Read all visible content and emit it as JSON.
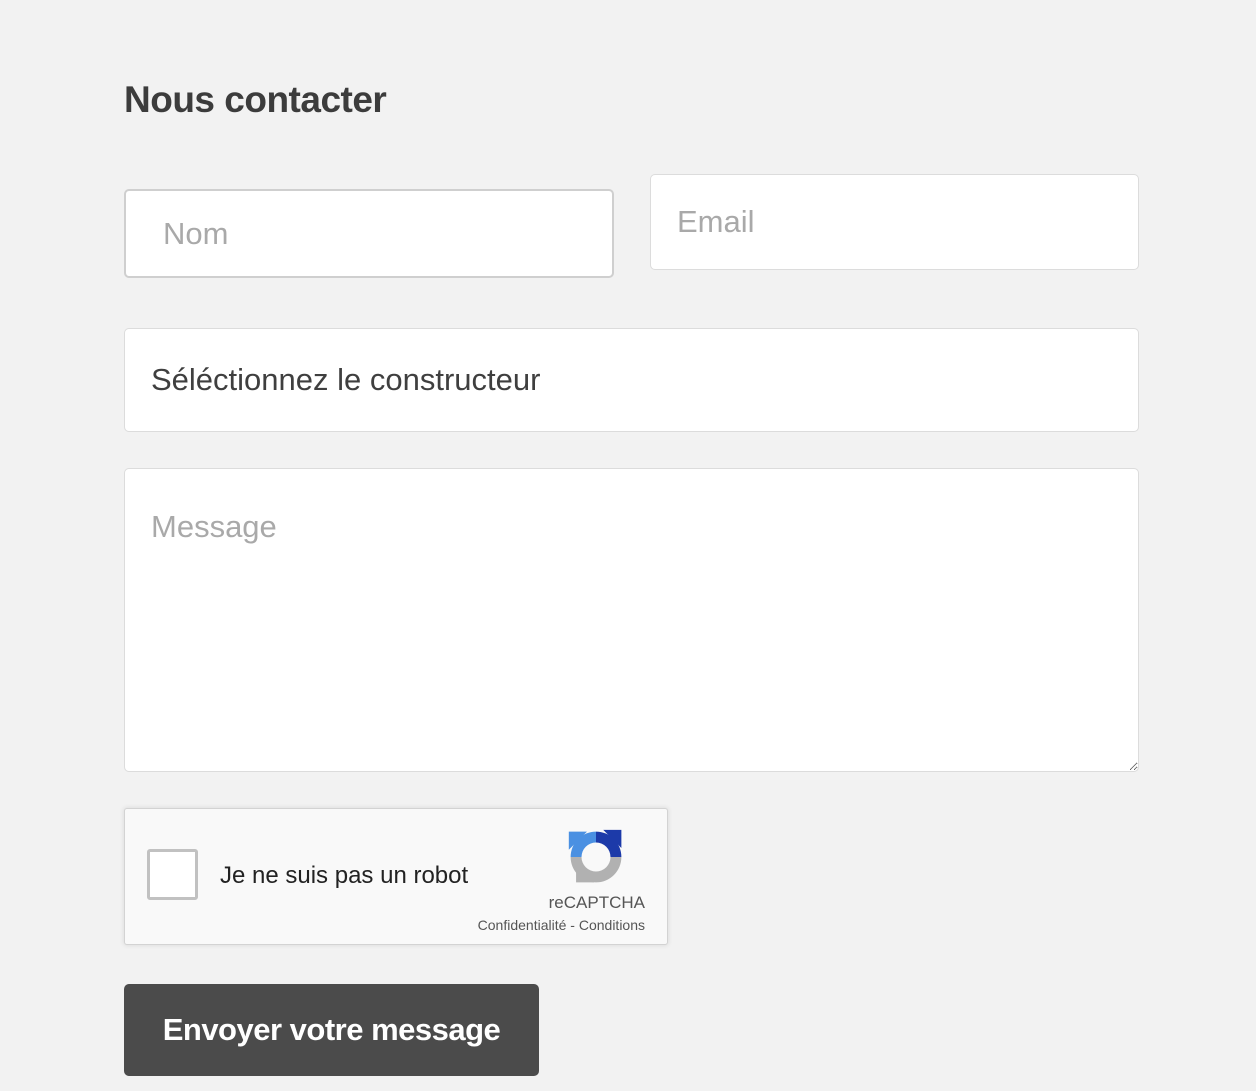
{
  "form": {
    "title": "Nous contacter",
    "name_placeholder": "Nom",
    "email_placeholder": "Email",
    "manufacturer_select_value": "Séléctionnez le constructeur",
    "message_placeholder": "Message",
    "submit_label": "Envoyer votre message"
  },
  "recaptcha": {
    "label": "Je ne suis pas un robot",
    "brand": "reCAPTCHA",
    "privacy_link": "Confidentialité",
    "separator": " - ",
    "terms_link": "Conditions",
    "logo_icon": "recaptcha-logo-icon",
    "colors": {
      "blue_dark": "#1c3aa9",
      "blue_light": "#4a90e2",
      "gray": "#b1b1b1"
    }
  },
  "colors": {
    "background": "#f2f2f2",
    "button": "#4b4b4b",
    "title": "#3c3c3c"
  }
}
